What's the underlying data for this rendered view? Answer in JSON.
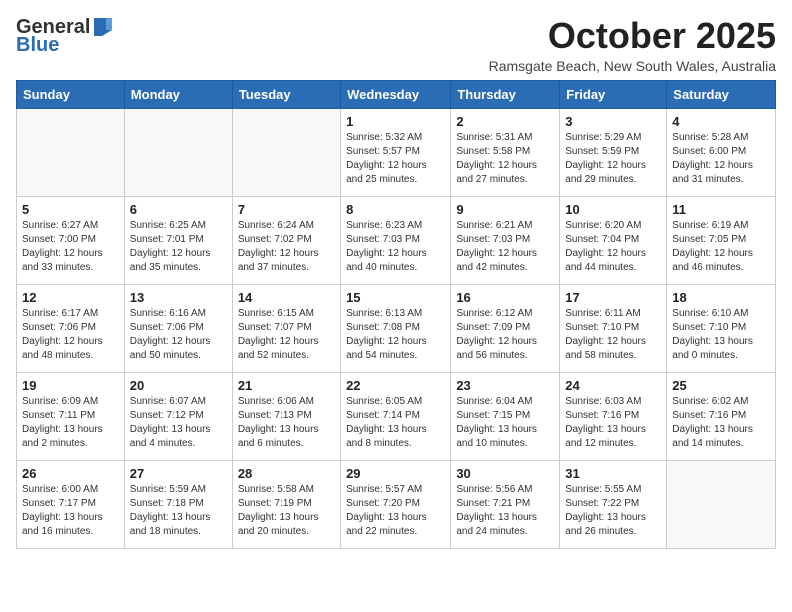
{
  "header": {
    "logo_general": "General",
    "logo_blue": "Blue",
    "title": "October 2025",
    "subtitle": "Ramsgate Beach, New South Wales, Australia"
  },
  "days_of_week": [
    "Sunday",
    "Monday",
    "Tuesday",
    "Wednesday",
    "Thursday",
    "Friday",
    "Saturday"
  ],
  "weeks": [
    [
      {
        "day": "",
        "info": ""
      },
      {
        "day": "",
        "info": ""
      },
      {
        "day": "",
        "info": ""
      },
      {
        "day": "1",
        "info": "Sunrise: 5:32 AM\nSunset: 5:57 PM\nDaylight: 12 hours\nand 25 minutes."
      },
      {
        "day": "2",
        "info": "Sunrise: 5:31 AM\nSunset: 5:58 PM\nDaylight: 12 hours\nand 27 minutes."
      },
      {
        "day": "3",
        "info": "Sunrise: 5:29 AM\nSunset: 5:59 PM\nDaylight: 12 hours\nand 29 minutes."
      },
      {
        "day": "4",
        "info": "Sunrise: 5:28 AM\nSunset: 6:00 PM\nDaylight: 12 hours\nand 31 minutes."
      }
    ],
    [
      {
        "day": "5",
        "info": "Sunrise: 6:27 AM\nSunset: 7:00 PM\nDaylight: 12 hours\nand 33 minutes."
      },
      {
        "day": "6",
        "info": "Sunrise: 6:25 AM\nSunset: 7:01 PM\nDaylight: 12 hours\nand 35 minutes."
      },
      {
        "day": "7",
        "info": "Sunrise: 6:24 AM\nSunset: 7:02 PM\nDaylight: 12 hours\nand 37 minutes."
      },
      {
        "day": "8",
        "info": "Sunrise: 6:23 AM\nSunset: 7:03 PM\nDaylight: 12 hours\nand 40 minutes."
      },
      {
        "day": "9",
        "info": "Sunrise: 6:21 AM\nSunset: 7:03 PM\nDaylight: 12 hours\nand 42 minutes."
      },
      {
        "day": "10",
        "info": "Sunrise: 6:20 AM\nSunset: 7:04 PM\nDaylight: 12 hours\nand 44 minutes."
      },
      {
        "day": "11",
        "info": "Sunrise: 6:19 AM\nSunset: 7:05 PM\nDaylight: 12 hours\nand 46 minutes."
      }
    ],
    [
      {
        "day": "12",
        "info": "Sunrise: 6:17 AM\nSunset: 7:06 PM\nDaylight: 12 hours\nand 48 minutes."
      },
      {
        "day": "13",
        "info": "Sunrise: 6:16 AM\nSunset: 7:06 PM\nDaylight: 12 hours\nand 50 minutes."
      },
      {
        "day": "14",
        "info": "Sunrise: 6:15 AM\nSunset: 7:07 PM\nDaylight: 12 hours\nand 52 minutes."
      },
      {
        "day": "15",
        "info": "Sunrise: 6:13 AM\nSunset: 7:08 PM\nDaylight: 12 hours\nand 54 minutes."
      },
      {
        "day": "16",
        "info": "Sunrise: 6:12 AM\nSunset: 7:09 PM\nDaylight: 12 hours\nand 56 minutes."
      },
      {
        "day": "17",
        "info": "Sunrise: 6:11 AM\nSunset: 7:10 PM\nDaylight: 12 hours\nand 58 minutes."
      },
      {
        "day": "18",
        "info": "Sunrise: 6:10 AM\nSunset: 7:10 PM\nDaylight: 13 hours\nand 0 minutes."
      }
    ],
    [
      {
        "day": "19",
        "info": "Sunrise: 6:09 AM\nSunset: 7:11 PM\nDaylight: 13 hours\nand 2 minutes."
      },
      {
        "day": "20",
        "info": "Sunrise: 6:07 AM\nSunset: 7:12 PM\nDaylight: 13 hours\nand 4 minutes."
      },
      {
        "day": "21",
        "info": "Sunrise: 6:06 AM\nSunset: 7:13 PM\nDaylight: 13 hours\nand 6 minutes."
      },
      {
        "day": "22",
        "info": "Sunrise: 6:05 AM\nSunset: 7:14 PM\nDaylight: 13 hours\nand 8 minutes."
      },
      {
        "day": "23",
        "info": "Sunrise: 6:04 AM\nSunset: 7:15 PM\nDaylight: 13 hours\nand 10 minutes."
      },
      {
        "day": "24",
        "info": "Sunrise: 6:03 AM\nSunset: 7:16 PM\nDaylight: 13 hours\nand 12 minutes."
      },
      {
        "day": "25",
        "info": "Sunrise: 6:02 AM\nSunset: 7:16 PM\nDaylight: 13 hours\nand 14 minutes."
      }
    ],
    [
      {
        "day": "26",
        "info": "Sunrise: 6:00 AM\nSunset: 7:17 PM\nDaylight: 13 hours\nand 16 minutes."
      },
      {
        "day": "27",
        "info": "Sunrise: 5:59 AM\nSunset: 7:18 PM\nDaylight: 13 hours\nand 18 minutes."
      },
      {
        "day": "28",
        "info": "Sunrise: 5:58 AM\nSunset: 7:19 PM\nDaylight: 13 hours\nand 20 minutes."
      },
      {
        "day": "29",
        "info": "Sunrise: 5:57 AM\nSunset: 7:20 PM\nDaylight: 13 hours\nand 22 minutes."
      },
      {
        "day": "30",
        "info": "Sunrise: 5:56 AM\nSunset: 7:21 PM\nDaylight: 13 hours\nand 24 minutes."
      },
      {
        "day": "31",
        "info": "Sunrise: 5:55 AM\nSunset: 7:22 PM\nDaylight: 13 hours\nand 26 minutes."
      },
      {
        "day": "",
        "info": ""
      }
    ]
  ]
}
